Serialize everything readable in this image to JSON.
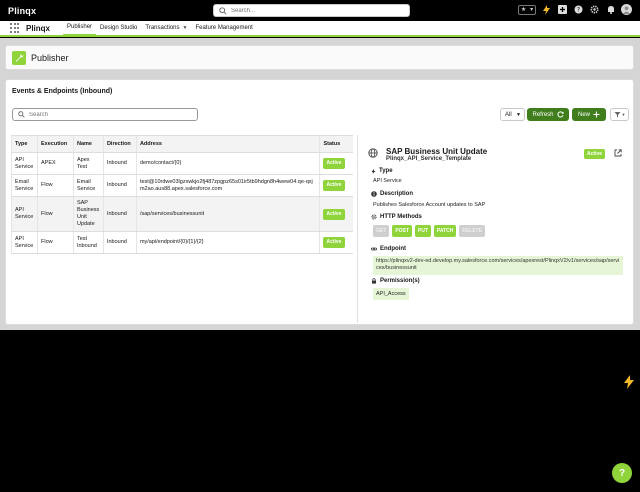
{
  "header": {
    "brand": "Plinqx",
    "search_placeholder": "Search..."
  },
  "nav": {
    "app_name": "Plinqx",
    "items": [
      {
        "label": "Publisher"
      },
      {
        "label": "Design Studio"
      },
      {
        "label": "Transactions"
      },
      {
        "label": "Feature Management"
      }
    ]
  },
  "page": {
    "title": "Publisher"
  },
  "card": {
    "title": "Events & Endpoints (Inbound)",
    "search_placeholder": "Search",
    "filter_value": "All",
    "refresh_label": "Refresh",
    "new_label": "New"
  },
  "table": {
    "columns": [
      "Type",
      "Execution",
      "Name",
      "Direction",
      "Address",
      "Status"
    ],
    "rows": [
      {
        "type": "API Service",
        "execution": "APEX",
        "name": "Apex Test",
        "direction": "Inbound",
        "address": "demo/contact/{0}",
        "status": "Active"
      },
      {
        "type": "Email Service",
        "execution": "Flow",
        "name": "Email Service",
        "direction": "Inbound",
        "address": "test@10rdwe03lgzswkjo2fj487zpgpz65s01ir5tb9hdgn8h4wew04.qe-qxjm2ao.aus88.apex.salesforce.com",
        "status": "Active"
      },
      {
        "type": "API Service",
        "execution": "Flow",
        "name": "SAP Business Unit Update",
        "direction": "Inbound",
        "address": "/sap/services/businessunit",
        "status": "Active"
      },
      {
        "type": "API Service",
        "execution": "Flow",
        "name": "Test Inbound",
        "direction": "Inbound",
        "address": "my/api/endpoint/{0}/{1}/{2}",
        "status": "Active"
      }
    ]
  },
  "detail": {
    "title": "SAP Business Unit Update",
    "subtitle": "Plinqx_API_Service_Template",
    "status": "Active",
    "type_label": "Type",
    "type_value": "API Service",
    "description_label": "Description",
    "description_value": "Publishes Salesforce Account updates to SAP",
    "methods_label": "HTTP Methods",
    "methods": [
      {
        "label": "GET",
        "enabled": false
      },
      {
        "label": "POST",
        "enabled": true
      },
      {
        "label": "PUT",
        "enabled": true
      },
      {
        "label": "PATCH",
        "enabled": true
      },
      {
        "label": "DELETE",
        "enabled": false
      }
    ],
    "endpoint_label": "Endpoint",
    "endpoint_value": "https://plinqxv2-dev-ed.develop.my.salesforce.com/services/apexrest/PlinqxV2/v1/services/sap/services/businessunit",
    "permissions_label": "Permission(s)",
    "permission_value": "API_Access"
  },
  "help": {
    "label": "?"
  },
  "colors": {
    "accent_green": "#8ed43a",
    "dark_green": "#3f7d1d",
    "endpoint_bg": "#e6f5d6"
  }
}
